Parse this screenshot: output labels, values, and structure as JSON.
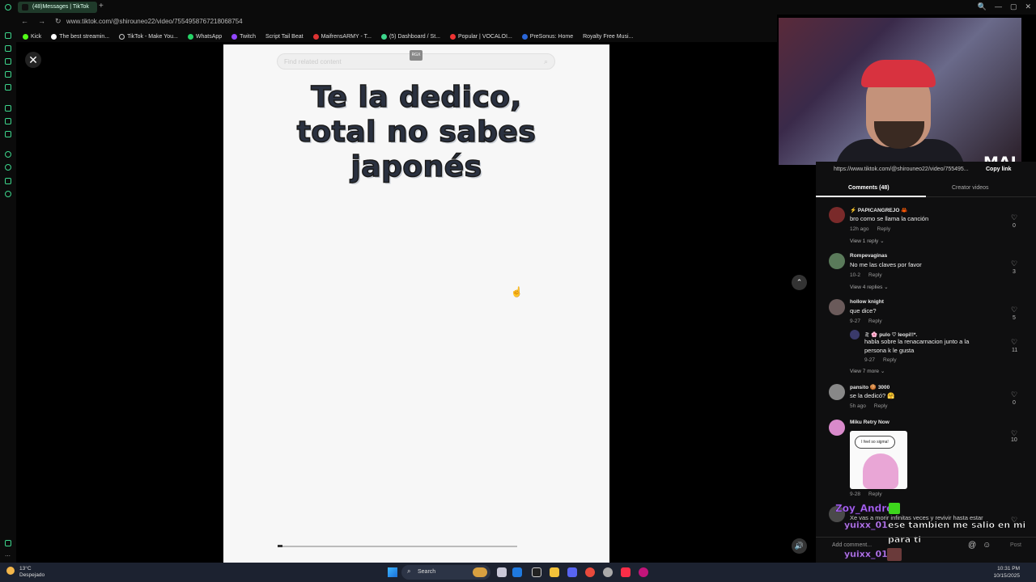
{
  "browser": {
    "tab_title": "(48)Messages | TikTok",
    "new_tab": "+",
    "url_prefix": "www.",
    "url": "www.tiktok.com/@shirouneo22/video/7554958767218068754",
    "nav": [
      "←",
      "→",
      "↻"
    ],
    "window_controls": [
      "🔍",
      "—",
      "▢",
      "✕"
    ],
    "bookmarks": [
      "Kick",
      "The best streamin...",
      "TikTok - Make You...",
      "WhatsApp",
      "Twitch",
      "Script Tail Beat",
      "MaifrensARMY - T...",
      "(5) Dashboard / St...",
      "Popular | VOCALOI...",
      "PreSonus: Home",
      "Royalty Free Musi..."
    ]
  },
  "player": {
    "close_icon": "✕",
    "search_placeholder": "Find related content",
    "search_icon": "⌕",
    "rgx_label": "RGX",
    "lyrics": [
      "Te la dedico,",
      "total no sabes",
      "japonés"
    ],
    "progress_fraction": 0.02,
    "cursor_icon": "☝"
  },
  "webcam": {
    "overlay_text": "MAI"
  },
  "panel": {
    "link": "https://www.tiktok.com/@shirouneo22/video/755495...",
    "copy_link": "Copy link",
    "tabs": {
      "comments": "Comments (48)",
      "creator": "Creator videos"
    },
    "scroll_up_icon": "⌃",
    "comments": [
      {
        "user": "⚡ PAPICANGREJO 🦀",
        "text": "bro como se llama la canción",
        "date": "12h ago",
        "reply": "Reply",
        "likes": "0",
        "more": "View 1 reply ⌄",
        "avatar_color": "#7a2a2a"
      },
      {
        "user": "Rompevaginas",
        "text": "No me las claves por favor",
        "date": "10-2",
        "reply": "Reply",
        "likes": "3",
        "more": "View 4 replies ⌄",
        "avatar_color": "#5a7a5a"
      },
      {
        "user": "hollow knight",
        "text": "que dice?",
        "date": "9-27",
        "reply": "Reply",
        "likes": "5",
        "more": "",
        "avatar_color": "#6a5a5a"
      },
      {
        "user": "pansito 🍪 3000",
        "text": "se la dedicó? 🤗",
        "date": "5h ago",
        "reply": "Reply",
        "likes": "0",
        "more": "",
        "avatar_color": "#888888"
      },
      {
        "user": "Miku Retry Now",
        "text": "",
        "date": "9-28",
        "reply": "Reply",
        "likes": "10",
        "more": "",
        "avatar_color": "#d98acb"
      }
    ],
    "nested_reply": {
      "user": "ミ 🌸 pulo ♡ leopi!!*.",
      "text_line1": "habla sobre la renacarnacion junto a la",
      "text_line2": "persona k le gusta",
      "date": "9-27",
      "reply": "Reply",
      "likes": "11",
      "more": "View 7 more ⌄"
    },
    "sticker_bubble": "I feel so sigma!",
    "partial_comment": {
      "user": "Zoy_Andre",
      "text": "Xe vas a morir infinitas veces y revivir hasta estar"
    },
    "add_comment": "Add comment...",
    "post": "Post",
    "input_icons": [
      "@",
      "☺"
    ],
    "volume_icon": "🔊"
  },
  "chat": {
    "line1_user": "yuixx_01",
    "line1_msg": "ese tambien me salio en mi",
    "line1_cont": "para ti",
    "line2_user": "yuixx_01"
  },
  "taskbar": {
    "temp": "13°C",
    "weather": "Despejado",
    "search": "Search",
    "time": "10:31 PM",
    "date": "10/15/2025"
  },
  "colors": {
    "accent_green": "#3dd68c",
    "chat_user": "#c98bff",
    "panel_bg": "#0f0f10",
    "video_bg": "#f7f7f7"
  }
}
